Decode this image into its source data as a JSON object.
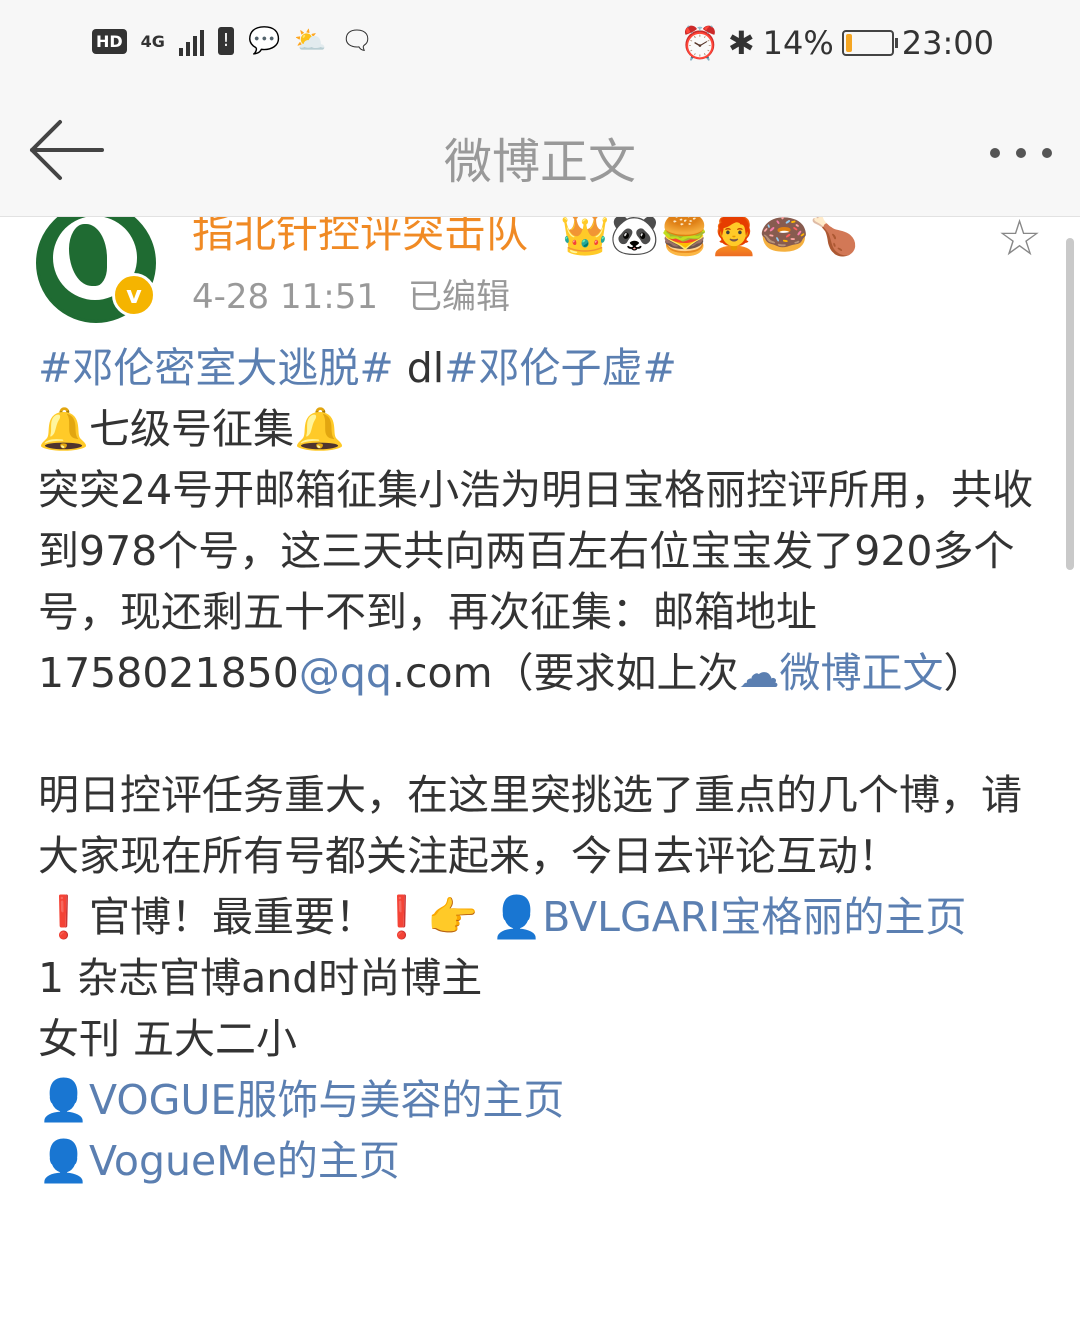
{
  "status_bar": {
    "hd": "HD",
    "network": "4G",
    "battery_percent": "14%",
    "battery_level": 0.14,
    "time": "23:00"
  },
  "nav": {
    "title": "微博正文"
  },
  "author": {
    "name": "指北针控评突击队",
    "stickers": "👑🐼🍔🧑‍🦰🍩🍗",
    "date": "4-28 11:51",
    "edited": "已编辑"
  },
  "post": {
    "line1_tag1": "#邓伦密室大逃脱#",
    "line1_mid": " dl",
    "line1_tag2": "#邓伦子虚#",
    "line2": "🔔七级号征集🔔",
    "para1_text": "突突24号开邮箱征集小浩为明日宝格丽控评所用，共收到978个号，这三天共向两百左右位宝宝发了920多个号，现还剩五十不到，再次征集：邮箱地址1758021850",
    "para1_email": "@qq",
    "para1_after": ".com（要求如上次",
    "para1_link": "☁微博正文",
    "para1_end": "）",
    "para2": "明日控评任务重大，在这里突挑选了重点的几个博，请大家现在所有号都关注起来，今日去评论互动！",
    "official_prefix": "❗官博！最重要！❗👉 ",
    "official_link": "👤BVLGARI宝格丽的主页",
    "line_mag": "1 杂志官博and时尚博主",
    "line_five": "女刊 五大二小",
    "link_vogue": "👤VOGUE服饰与美容的主页",
    "link_vogueme": "👤VogueMe的主页"
  },
  "colors": {
    "link": "#5b7fb1",
    "author_name": "#f08a24",
    "meta": "#999999"
  }
}
